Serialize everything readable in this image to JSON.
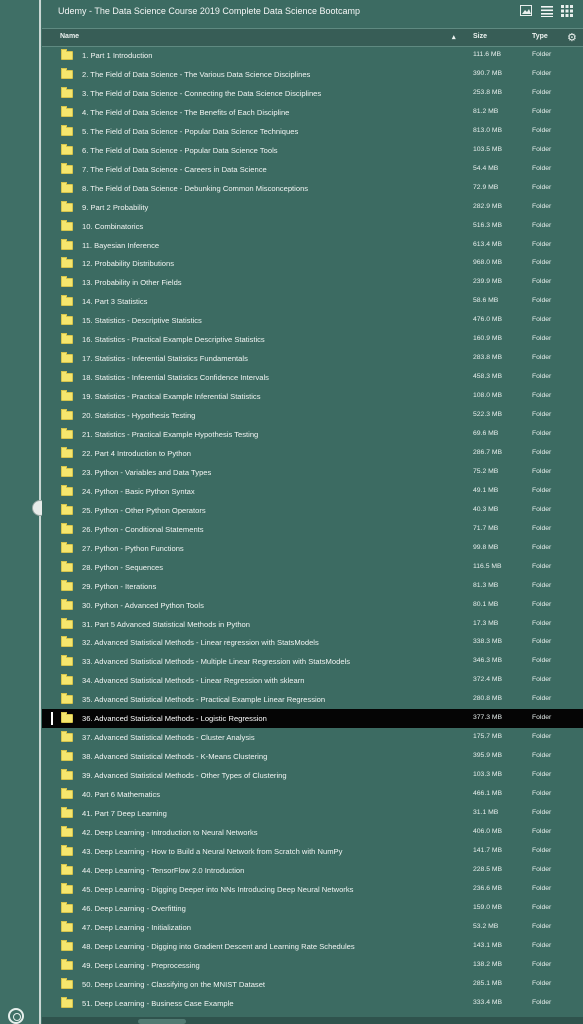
{
  "window": {
    "title": "Udemy - The Data Science Course 2019 Complete Data Science Bootcamp"
  },
  "toolbar": {
    "icons": [
      "image-icon",
      "list-view-icon",
      "grid-view-icon"
    ]
  },
  "header": {
    "name": "Name",
    "sort": "▴",
    "size": "Size",
    "type": "Type",
    "gear": "⚙"
  },
  "files": [
    {
      "name": "1. Part 1 Introduction",
      "size": "111.6 MB",
      "type": "Folder"
    },
    {
      "name": "2. The Field of Data Science - The Various Data Science Disciplines",
      "size": "390.7 MB",
      "type": "Folder"
    },
    {
      "name": "3. The Field of Data Science - Connecting the Data Science Disciplines",
      "size": "253.8 MB",
      "type": "Folder"
    },
    {
      "name": "4. The Field of Data Science - The Benefits of Each Discipline",
      "size": "81.2 MB",
      "type": "Folder"
    },
    {
      "name": "5. The Field of Data Science - Popular Data Science Techniques",
      "size": "813.0 MB",
      "type": "Folder"
    },
    {
      "name": "6. The Field of Data Science - Popular Data Science Tools",
      "size": "103.5 MB",
      "type": "Folder"
    },
    {
      "name": "7. The Field of Data Science - Careers in Data Science",
      "size": "54.4 MB",
      "type": "Folder"
    },
    {
      "name": "8. The Field of Data Science - Debunking Common Misconceptions",
      "size": "72.9 MB",
      "type": "Folder"
    },
    {
      "name": "9. Part 2 Probability",
      "size": "282.9 MB",
      "type": "Folder"
    },
    {
      "name": "10. Combinatorics",
      "size": "516.3 MB",
      "type": "Folder"
    },
    {
      "name": "11. Bayesian Inference",
      "size": "613.4 MB",
      "type": "Folder"
    },
    {
      "name": "12. Probability Distributions",
      "size": "968.0 MB",
      "type": "Folder"
    },
    {
      "name": "13. Probability in Other Fields",
      "size": "239.9 MB",
      "type": "Folder"
    },
    {
      "name": "14. Part 3 Statistics",
      "size": "58.6 MB",
      "type": "Folder"
    },
    {
      "name": "15. Statistics - Descriptive Statistics",
      "size": "476.0 MB",
      "type": "Folder"
    },
    {
      "name": "16. Statistics - Practical Example Descriptive Statistics",
      "size": "160.9 MB",
      "type": "Folder"
    },
    {
      "name": "17. Statistics - Inferential Statistics Fundamentals",
      "size": "283.8 MB",
      "type": "Folder"
    },
    {
      "name": "18. Statistics - Inferential Statistics Confidence Intervals",
      "size": "458.3 MB",
      "type": "Folder"
    },
    {
      "name": "19. Statistics - Practical Example Inferential Statistics",
      "size": "108.0 MB",
      "type": "Folder"
    },
    {
      "name": "20. Statistics - Hypothesis Testing",
      "size": "522.3 MB",
      "type": "Folder"
    },
    {
      "name": "21. Statistics - Practical Example Hypothesis Testing",
      "size": "69.6 MB",
      "type": "Folder"
    },
    {
      "name": "22. Part 4 Introduction to Python",
      "size": "286.7 MB",
      "type": "Folder"
    },
    {
      "name": "23. Python - Variables and Data Types",
      "size": "75.2 MB",
      "type": "Folder"
    },
    {
      "name": "24. Python - Basic Python Syntax",
      "size": "49.1 MB",
      "type": "Folder"
    },
    {
      "name": "25. Python - Other Python Operators",
      "size": "40.3 MB",
      "type": "Folder"
    },
    {
      "name": "26. Python - Conditional Statements",
      "size": "71.7 MB",
      "type": "Folder"
    },
    {
      "name": "27. Python - Python Functions",
      "size": "99.8 MB",
      "type": "Folder"
    },
    {
      "name": "28. Python - Sequences",
      "size": "116.5 MB",
      "type": "Folder"
    },
    {
      "name": "29. Python - Iterations",
      "size": "81.3 MB",
      "type": "Folder"
    },
    {
      "name": "30. Python - Advanced Python Tools",
      "size": "80.1 MB",
      "type": "Folder"
    },
    {
      "name": "31. Part 5 Advanced Statistical Methods in Python",
      "size": "17.3 MB",
      "type": "Folder"
    },
    {
      "name": "32. Advanced Statistical Methods - Linear regression with StatsModels",
      "size": "338.3 MB",
      "type": "Folder"
    },
    {
      "name": "33. Advanced Statistical Methods - Multiple Linear Regression with StatsModels",
      "size": "346.3 MB",
      "type": "Folder"
    },
    {
      "name": "34. Advanced Statistical Methods - Linear Regression with sklearn",
      "size": "372.4 MB",
      "type": "Folder"
    },
    {
      "name": "35. Advanced Statistical Methods - Practical Example Linear Regression",
      "size": "280.8 MB",
      "type": "Folder"
    },
    {
      "name": "36. Advanced Statistical Methods - Logistic Regression",
      "size": "377.3 MB",
      "type": "Folder",
      "selected": true
    },
    {
      "name": "37. Advanced Statistical Methods - Cluster Analysis",
      "size": "175.7 MB",
      "type": "Folder"
    },
    {
      "name": "38. Advanced Statistical Methods - K-Means Clustering",
      "size": "395.9 MB",
      "type": "Folder"
    },
    {
      "name": "39. Advanced Statistical Methods - Other Types of Clustering",
      "size": "103.3 MB",
      "type": "Folder"
    },
    {
      "name": "40. Part 6 Mathematics",
      "size": "466.1 MB",
      "type": "Folder"
    },
    {
      "name": "41. Part 7 Deep Learning",
      "size": "31.1 MB",
      "type": "Folder"
    },
    {
      "name": "42. Deep Learning - Introduction to Neural Networks",
      "size": "406.0 MB",
      "type": "Folder"
    },
    {
      "name": "43. Deep Learning - How to Build a Neural Network from Scratch with NumPy",
      "size": "141.7 MB",
      "type": "Folder"
    },
    {
      "name": "44. Deep Learning - TensorFlow 2.0 Introduction",
      "size": "228.5 MB",
      "type": "Folder"
    },
    {
      "name": "45. Deep Learning - Digging Deeper into NNs Introducing Deep Neural Networks",
      "size": "236.6 MB",
      "type": "Folder"
    },
    {
      "name": "46. Deep Learning - Overfitting",
      "size": "159.0 MB",
      "type": "Folder"
    },
    {
      "name": "47. Deep Learning - Initialization",
      "size": "53.2 MB",
      "type": "Folder"
    },
    {
      "name": "48. Deep Learning - Digging into Gradient Descent and Learning Rate Schedules",
      "size": "143.1 MB",
      "type": "Folder"
    },
    {
      "name": "49. Deep Learning - Preprocessing",
      "size": "138.2 MB",
      "type": "Folder"
    },
    {
      "name": "50. Deep Learning - Classifying on the MNIST Dataset",
      "size": "285.1 MB",
      "type": "Folder"
    },
    {
      "name": "51. Deep Learning - Business Case Example",
      "size": "333.4 MB",
      "type": "Folder"
    }
  ],
  "colors": {
    "background": "#3c6b62",
    "selected_row": "#050505",
    "folder": "#f5e66d"
  }
}
